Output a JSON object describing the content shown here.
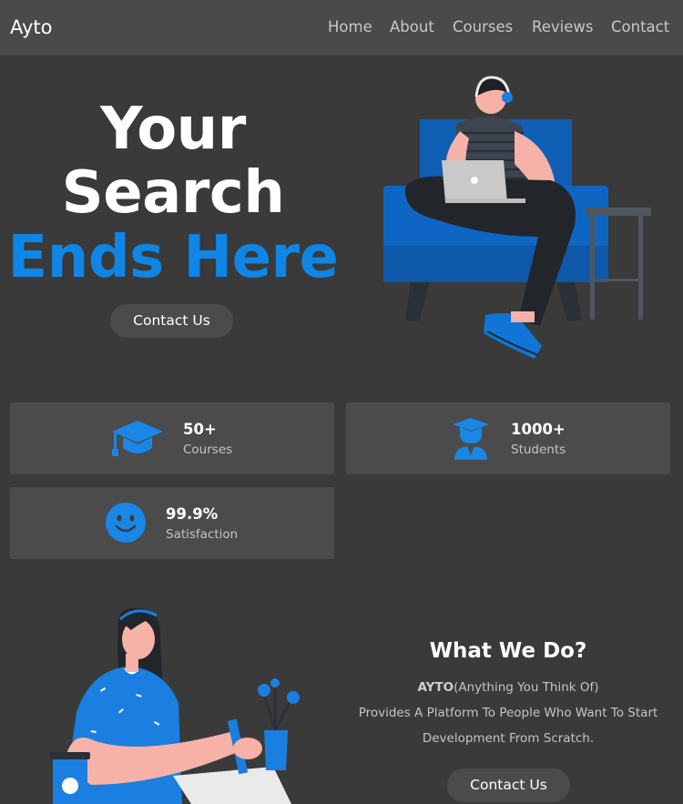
{
  "nav": {
    "brand": "Ayto",
    "links": [
      "Home",
      "About",
      "Courses",
      "Reviews",
      "Contact"
    ]
  },
  "hero": {
    "title_line1": "Your",
    "title_line2": "Search",
    "title_line3": "Ends Here",
    "cta_label": "Contact Us"
  },
  "stats": [
    {
      "value": "50+",
      "label": "Courses",
      "icon": "graduation-cap-icon"
    },
    {
      "value": "1000+",
      "label": "Students",
      "icon": "student-icon"
    },
    {
      "value": "99.9%",
      "label": "Satisfaction",
      "icon": "smiley-face-icon"
    }
  ],
  "about": {
    "title": "What We Do?",
    "brand_bold": "AYTO",
    "brand_expansion": "(Anything You Think Of)",
    "line2": "Provides A Platform To People Who Want To Start",
    "line3": "Development From Scratch.",
    "cta_label": "Contact Us"
  },
  "colors": {
    "accent": "#0f86e6",
    "background": "#3a3a3a",
    "navbar": "#4a4a4a",
    "card": "#4b4b4b"
  }
}
